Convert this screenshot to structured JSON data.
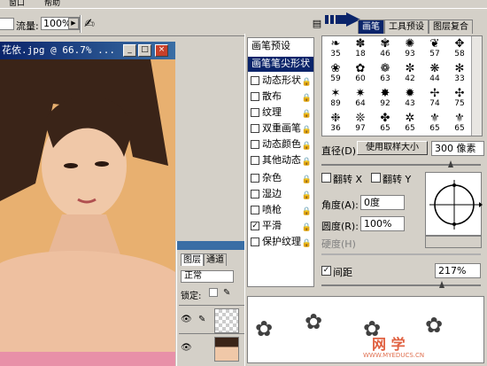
{
  "menubar": {
    "items": [
      "窗口",
      "帮助"
    ]
  },
  "options": {
    "flow_label": "流量:",
    "flow_value": "100%",
    "airbrush_icon": "airbrush-icon"
  },
  "dock": {
    "tabs": [
      "画笔",
      "工具预设",
      "图层复合"
    ],
    "active_tab": 0
  },
  "document": {
    "title": "花依.jpg @ 66.7% ...",
    "min": "_",
    "max": "□",
    "close": "×"
  },
  "layers": {
    "tabs": [
      "图层",
      "通道"
    ],
    "blend_mode": "正常",
    "lock_label": "锁定:"
  },
  "brushes": {
    "sidebar": [
      {
        "label": "画笔预设",
        "type": "header"
      },
      {
        "label": "画笔笔尖形状",
        "type": "selected"
      },
      {
        "label": "动态形状",
        "checked": false
      },
      {
        "label": "散布",
        "checked": false
      },
      {
        "label": "纹理",
        "checked": false
      },
      {
        "label": "双重画笔",
        "checked": false
      },
      {
        "label": "动态颜色",
        "checked": false
      },
      {
        "label": "其他动态",
        "checked": false
      },
      {
        "label": "杂色",
        "checked": false
      },
      {
        "label": "湿边",
        "checked": false
      },
      {
        "label": "喷枪",
        "checked": false
      },
      {
        "label": "平滑",
        "checked": true
      },
      {
        "label": "保护纹理",
        "checked": false
      }
    ],
    "tips": [
      {
        "glyph": "❧",
        "n": "35"
      },
      {
        "glyph": "✽",
        "n": "18"
      },
      {
        "glyph": "✾",
        "n": "46"
      },
      {
        "glyph": "✺",
        "n": "93"
      },
      {
        "glyph": "❦",
        "n": "57"
      },
      {
        "glyph": "✥",
        "n": "58"
      },
      {
        "glyph": "❀",
        "n": "59"
      },
      {
        "glyph": "✿",
        "n": "60"
      },
      {
        "glyph": "❁",
        "n": "63"
      },
      {
        "glyph": "✼",
        "n": "42"
      },
      {
        "glyph": "❋",
        "n": "44"
      },
      {
        "glyph": "✻",
        "n": "33"
      },
      {
        "glyph": "✶",
        "n": "89"
      },
      {
        "glyph": "✷",
        "n": "64"
      },
      {
        "glyph": "✸",
        "n": "92"
      },
      {
        "glyph": "✹",
        "n": "43"
      },
      {
        "glyph": "✢",
        "n": "74"
      },
      {
        "glyph": "✣",
        "n": "75"
      },
      {
        "glyph": "❉",
        "n": "36"
      },
      {
        "glyph": "❊",
        "n": "97"
      },
      {
        "glyph": "✤",
        "n": "65"
      },
      {
        "glyph": "✲",
        "n": "65"
      },
      {
        "glyph": "⚜",
        "n": "65"
      },
      {
        "glyph": "⚜",
        "n": "65"
      }
    ],
    "diameter_label": "直径(D)",
    "use_sample_label": "使用取样大小",
    "diameter_value": "300 像素",
    "flip_x_label": "翻转 X",
    "flip_y_label": "翻转 Y",
    "angle_label": "角度(A):",
    "angle_value": "0度",
    "roundness_label": "圆度(R):",
    "roundness_value": "100%",
    "hardness_label": "硬度(H)",
    "spacing_label": "间距",
    "spacing_checked": true,
    "spacing_value": "217%"
  },
  "watermark": {
    "text": "网 学",
    "url": "WWW.MYEDUCS.CN"
  }
}
